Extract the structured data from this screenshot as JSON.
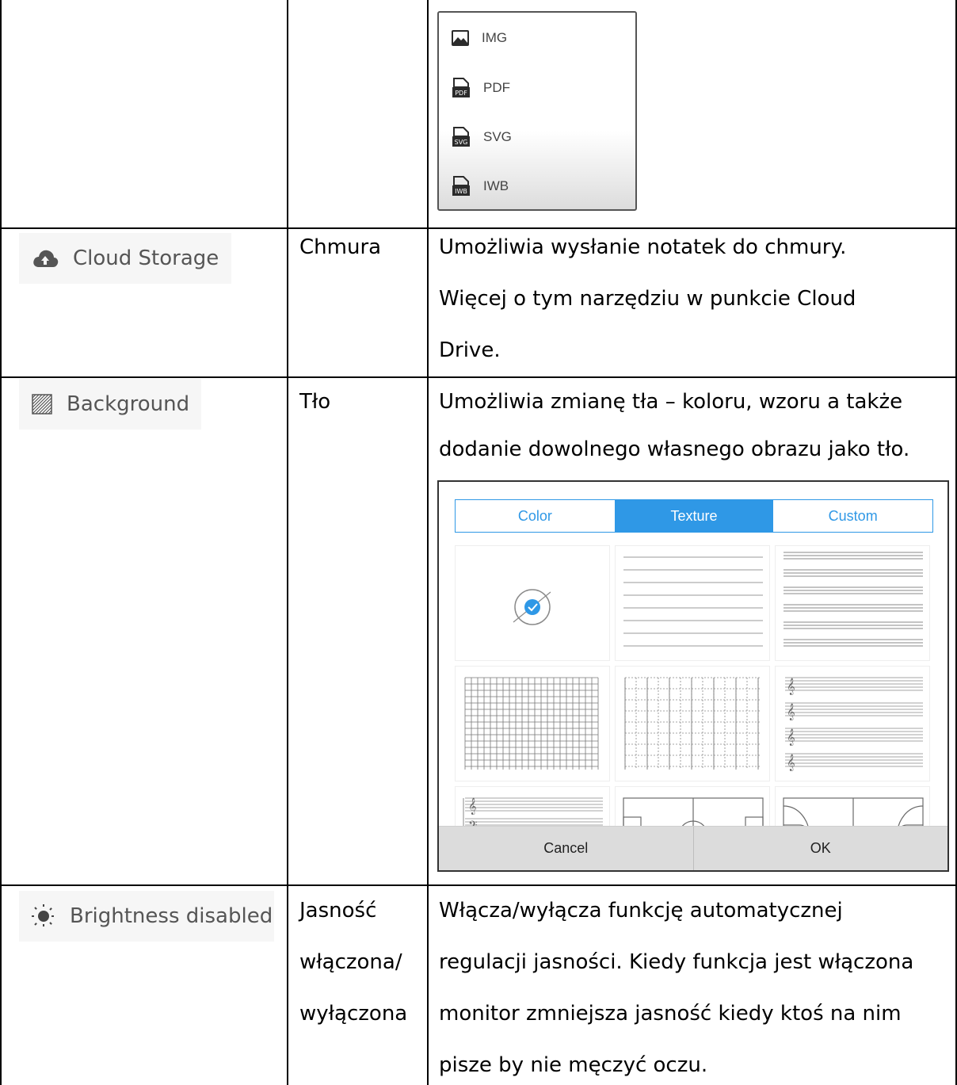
{
  "export_menu": {
    "items": [
      {
        "label": "IMG",
        "icon": "image-icon"
      },
      {
        "label": "PDF",
        "icon": "pdf-file-icon",
        "badge": "PDF"
      },
      {
        "label": "SVG",
        "icon": "svg-file-icon",
        "badge": "SVG"
      },
      {
        "label": "IWB",
        "icon": "iwb-file-icon",
        "badge": "IWB"
      }
    ]
  },
  "rows": {
    "cloud": {
      "menu_label": "Cloud Storage",
      "name": "Chmura",
      "description_lines": [
        "Umożliwia wysłanie notatek do chmury.",
        "Więcej o tym narzędziu w punkcie Cloud",
        "Drive."
      ]
    },
    "background": {
      "menu_label": "Background",
      "name": "Tło",
      "description_lines": [
        "Umożliwia zmianę tła – koloru, wzoru a także",
        "dodanie dowolnego własnego obrazu jako tło."
      ],
      "dialog": {
        "tabs": [
          "Color",
          "Texture",
          "Custom"
        ],
        "active_tab": "Texture",
        "cancel_label": "Cancel",
        "ok_label": "OK",
        "accent_color": "#2f98e6"
      }
    },
    "brightness": {
      "menu_label": "Brightness disabled",
      "name_lines": [
        "Jasność",
        "włączona/",
        "wyłączona"
      ],
      "description_lines": [
        "Włącza/wyłącza funkcję automatycznej",
        "regulacji jasności. Kiedy funkcja jest włączona",
        "monitor zmniejsza jasność kiedy ktoś na nim",
        "pisze by nie męczyć oczu."
      ]
    }
  }
}
